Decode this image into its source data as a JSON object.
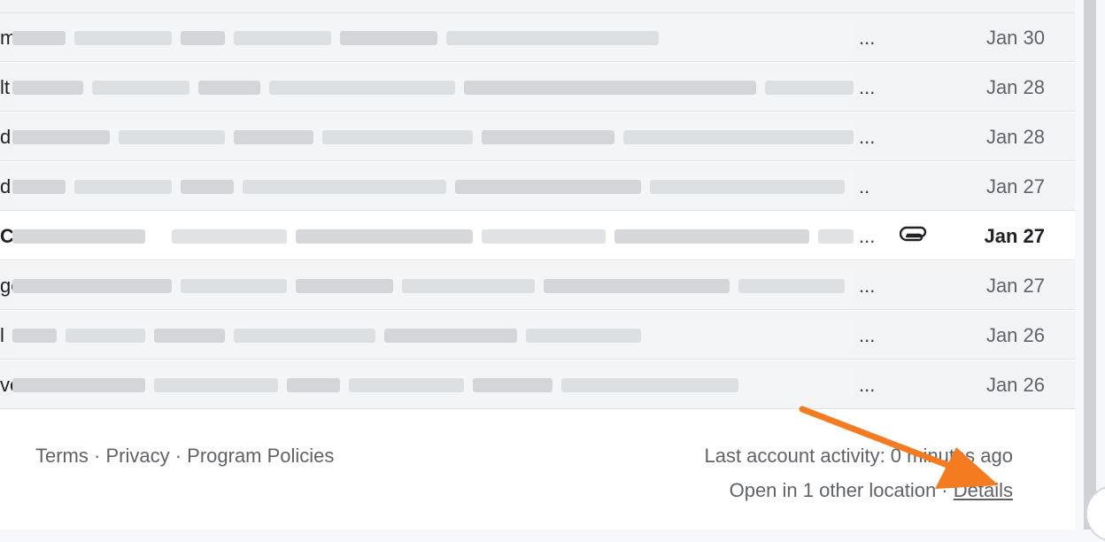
{
  "email_list": {
    "rows": [
      {
        "lead": "m",
        "ellipsis": "...",
        "date": "Jan 30",
        "unread": false,
        "attachment": false
      },
      {
        "lead": "lt",
        "ellipsis": "...",
        "date": "Jan 28",
        "unread": false,
        "attachment": false
      },
      {
        "lead": "d",
        "ellipsis": "...",
        "date": "Jan 28",
        "unread": false,
        "attachment": false
      },
      {
        "lead": "d",
        "ellipsis": "..",
        "date": "Jan 27",
        "unread": false,
        "attachment": false
      },
      {
        "lead": "C",
        "ellipsis": "...",
        "date": "Jan 27",
        "unread": true,
        "attachment": true
      },
      {
        "lead": "ge",
        "ellipsis": "...",
        "date": "Jan 27",
        "unread": false,
        "attachment": false
      },
      {
        "lead": "l",
        "ellipsis": "...",
        "date": "Jan 26",
        "unread": false,
        "attachment": false
      },
      {
        "lead": "ve",
        "ellipsis": "...",
        "date": "Jan 26",
        "unread": false,
        "attachment": false
      }
    ]
  },
  "footer": {
    "links_text": "Terms · Privacy · Program Policies",
    "terms": "Terms",
    "privacy": "Privacy",
    "program_policies": "Program Policies",
    "separator": " · ",
    "last_activity": "Last account activity: 0 minutes ago",
    "open_locations": "Open in 1 other location · ",
    "details": "Details"
  },
  "annotation": {
    "arrow_color": "#F47B20"
  }
}
